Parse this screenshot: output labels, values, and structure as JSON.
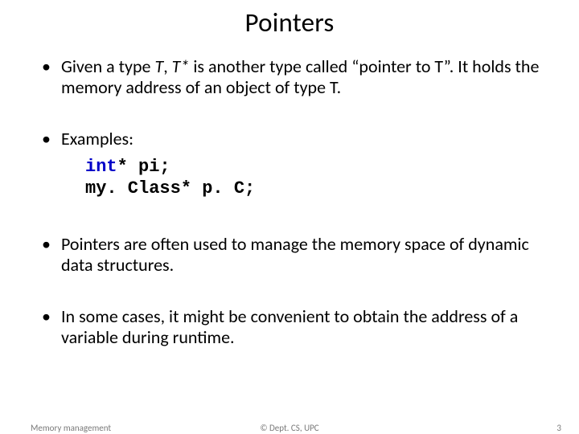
{
  "title": "Pointers",
  "bullets": {
    "b1_pre": "Given a type ",
    "b1_T": "T",
    "b1_mid": ", ",
    "b1_Tstar": "T*",
    "b1_post": " is another type called “pointer to T”. It holds the memory address of an object of type T.",
    "b2": "Examples:",
    "b3": "Pointers are often used to manage the memory space of dynamic data structures.",
    "b4": "In some cases, it might be convenient to obtain the address of a variable during runtime."
  },
  "code": {
    "kw1": "int",
    "line1_rest": "* pi;",
    "line2": "my. Class* p. C;"
  },
  "footer": {
    "left": "Memory management",
    "center": "© Dept. CS, UPC",
    "right": "3"
  }
}
